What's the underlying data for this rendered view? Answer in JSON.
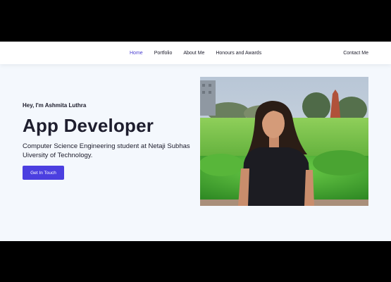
{
  "nav": {
    "links": [
      {
        "label": "Home",
        "active": true
      },
      {
        "label": "Portfolio",
        "active": false
      },
      {
        "label": "About Me",
        "active": false
      },
      {
        "label": "Honours and Awards",
        "active": false
      }
    ],
    "contact_label": "Contact Me"
  },
  "hero": {
    "greeting": "Hey, I'm Ashmita Luthra",
    "headline": "App Developer",
    "description": "Computer Science Engineering student at Netaji Subhas Uiversity of Technology.",
    "cta_label": "Get In Touch"
  },
  "colors": {
    "accent": "#4b3fe0",
    "nav_active": "#4a3fd0",
    "background": "#f4f8fd"
  }
}
